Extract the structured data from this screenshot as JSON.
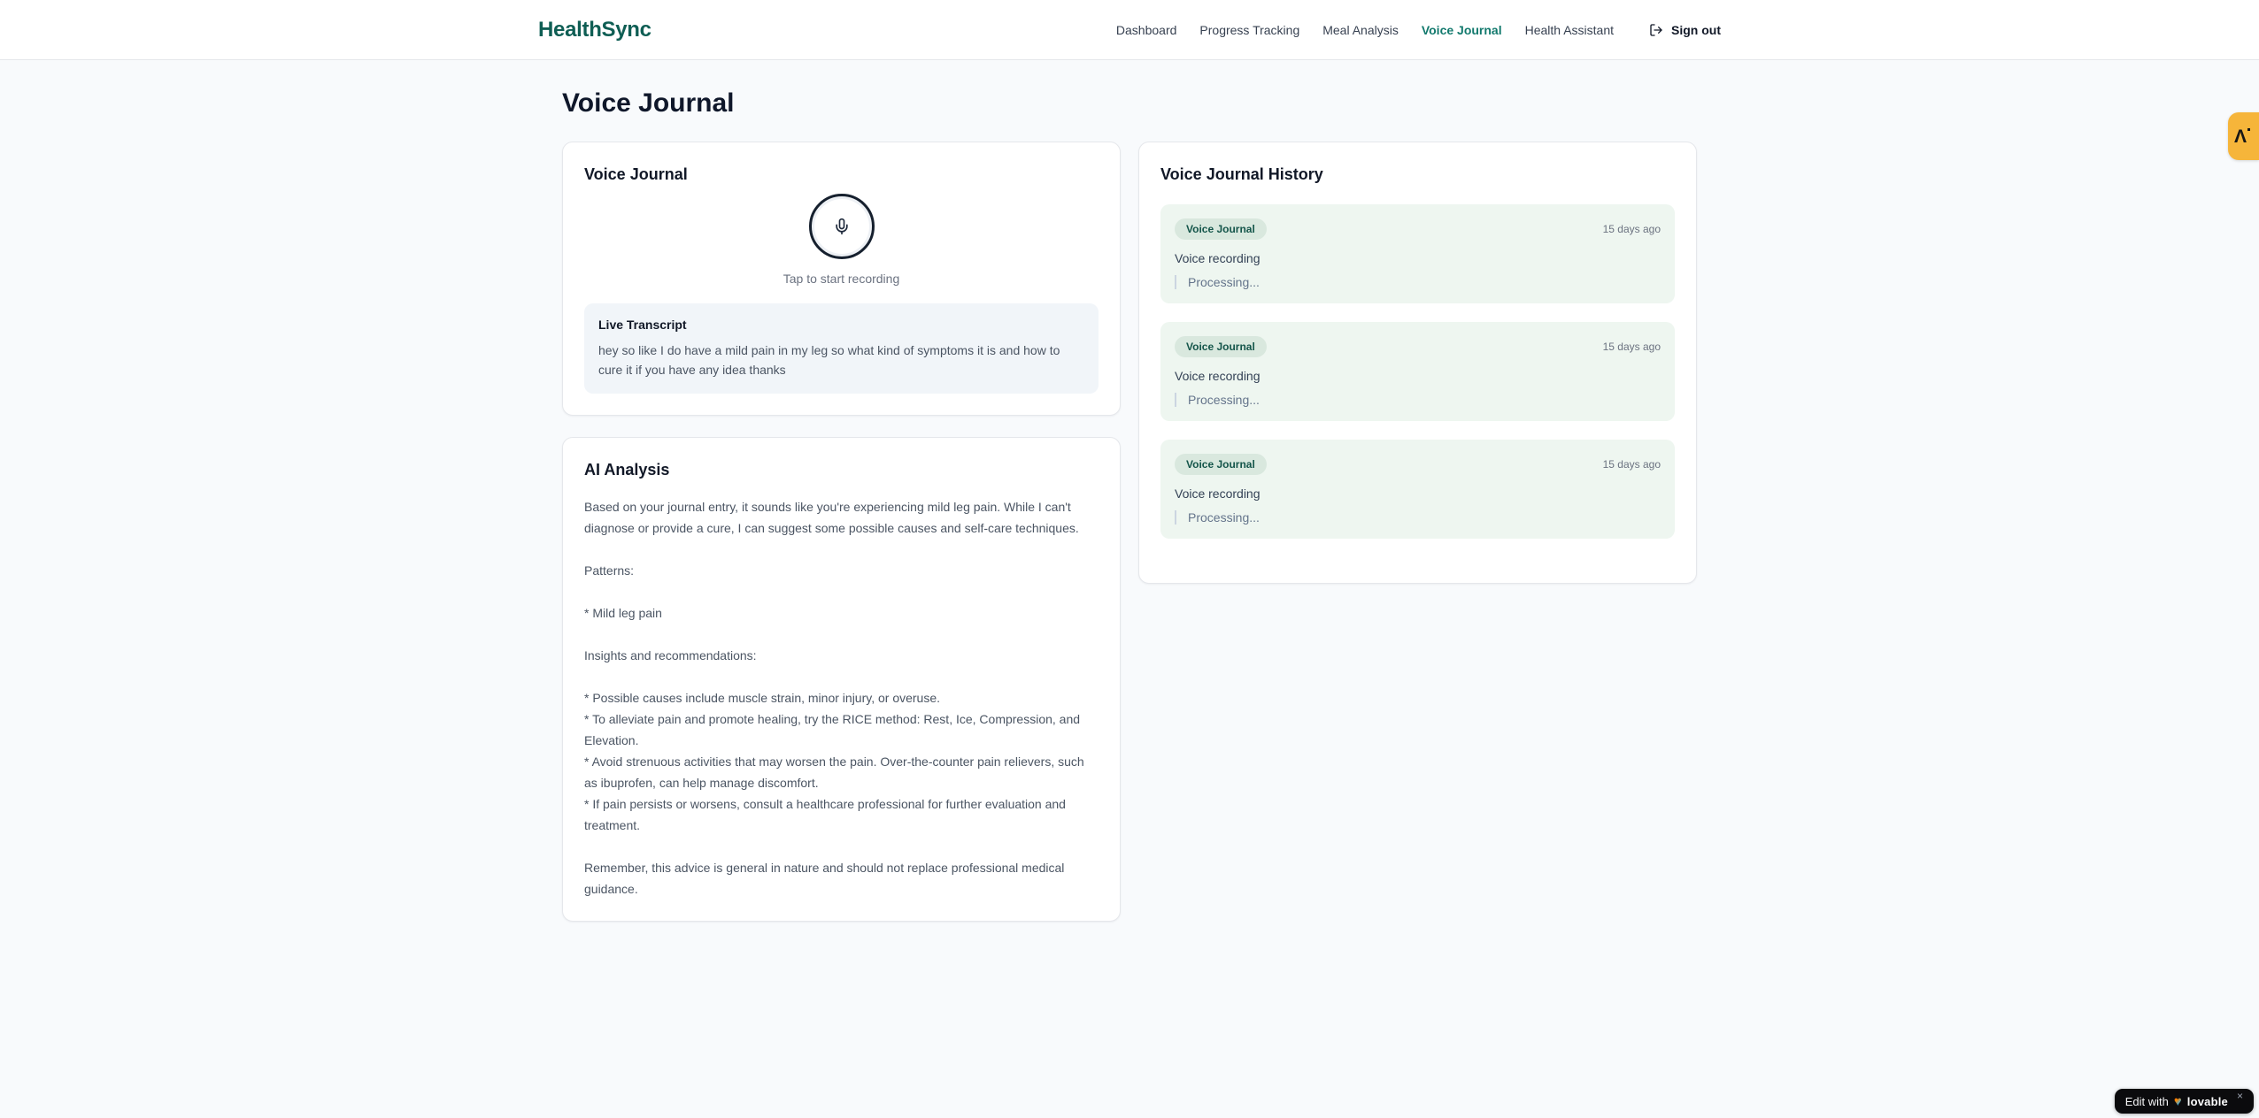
{
  "brand": {
    "name": "HealthSync"
  },
  "nav": {
    "items": [
      {
        "label": "Dashboard",
        "active": false
      },
      {
        "label": "Progress Tracking",
        "active": false
      },
      {
        "label": "Meal Analysis",
        "active": false
      },
      {
        "label": "Voice Journal",
        "active": true
      },
      {
        "label": "Health Assistant",
        "active": false
      }
    ],
    "signout_label": "Sign out"
  },
  "page": {
    "title": "Voice Journal"
  },
  "recorder": {
    "card_title": "Voice Journal",
    "tap_hint": "Tap to start recording",
    "live_transcript_label": "Live Transcript",
    "transcript": "hey so like I do have a mild pain in my leg so what kind of symptoms it is and how to cure it if you have any idea thanks"
  },
  "analysis": {
    "card_title": "AI Analysis",
    "body": "Based on your journal entry, it sounds like you're experiencing mild leg pain. While I can't diagnose or provide a cure, I can suggest some possible causes and self-care techniques.\n\nPatterns:\n\n* Mild leg pain\n\nInsights and recommendations:\n\n* Possible causes include muscle strain, minor injury, or overuse.\n* To alleviate pain and promote healing, try the RICE method: Rest, Ice, Compression, and Elevation.\n* Avoid strenuous activities that may worsen the pain. Over-the-counter pain relievers, such as ibuprofen, can help manage discomfort.\n* If pain persists or worsens, consult a healthcare professional for further evaluation and treatment.\n\nRemember, this advice is general in nature and should not replace professional medical guidance."
  },
  "history": {
    "card_title": "Voice Journal History",
    "entries": [
      {
        "badge": "Voice Journal",
        "time": "15 days ago",
        "title": "Voice recording",
        "status": "Processing..."
      },
      {
        "badge": "Voice Journal",
        "time": "15 days ago",
        "title": "Voice recording",
        "status": "Processing..."
      },
      {
        "badge": "Voice Journal",
        "time": "15 days ago",
        "title": "Voice recording",
        "status": "Processing..."
      }
    ]
  },
  "badges": {
    "edge_glyph": "Λ",
    "edit_with": "Edit with",
    "heart": "♥",
    "lovable": "lovable",
    "close": "×"
  },
  "colors": {
    "brand_teal": "#0f5e54",
    "active_nav": "#12796d",
    "history_entry_bg": "#eef6f0",
    "badge_bg": "#d9e8de",
    "badge_text": "#14554a",
    "edge_badge_bg": "#f6b53a",
    "page_bg": "#f8fafc"
  }
}
